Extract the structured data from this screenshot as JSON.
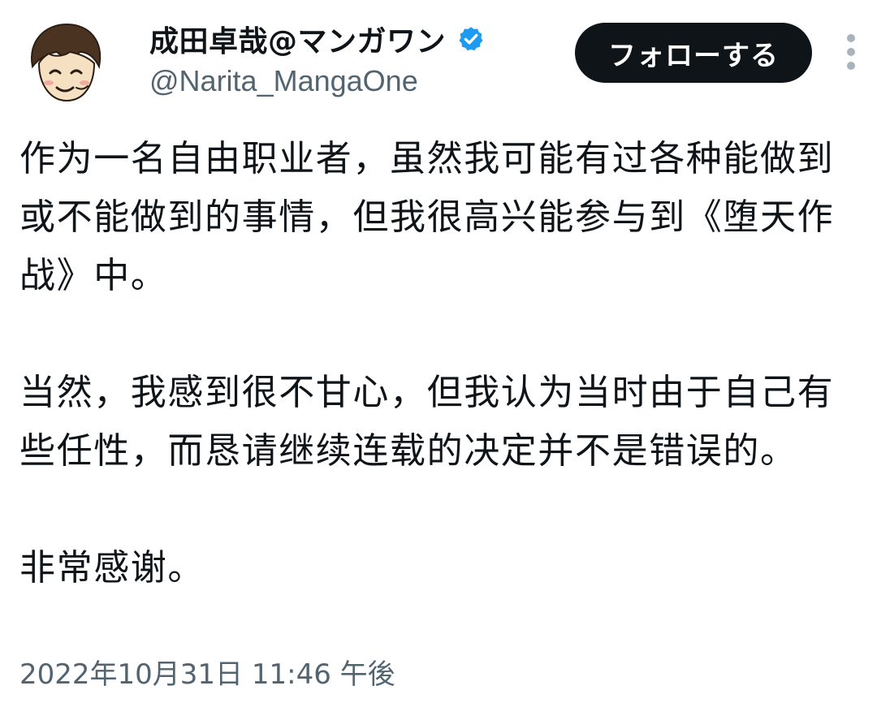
{
  "author": {
    "avatar_icon": "cartoon-avatar-icon",
    "display_name": "成田卓哉@マンガワン",
    "verified_icon": "verified-badge-icon",
    "verified_color": "#1d9bf0",
    "handle": "@Narita_MangaOne"
  },
  "actions": {
    "follow_label": "フォローする",
    "more_icon": "more-options-vertical-icon"
  },
  "tweet": {
    "paragraphs": [
      "作为一名自由职业者，虽然我可能有过各种能做到或不能做到的事情，但我很高兴能参与到《堕天作战》中。",
      "当然，我感到很不甘心，但我认为当时由于自己有些任性，而恳请继续连载的决定并不是错误的。",
      "非常感谢。"
    ],
    "timestamp": "2022年10月31日 11:46 午後"
  },
  "colors": {
    "text_primary": "#0f1419",
    "text_secondary": "#536471",
    "follow_button_bg": "#0f1419",
    "follow_button_text": "#ffffff",
    "background": "#ffffff"
  }
}
